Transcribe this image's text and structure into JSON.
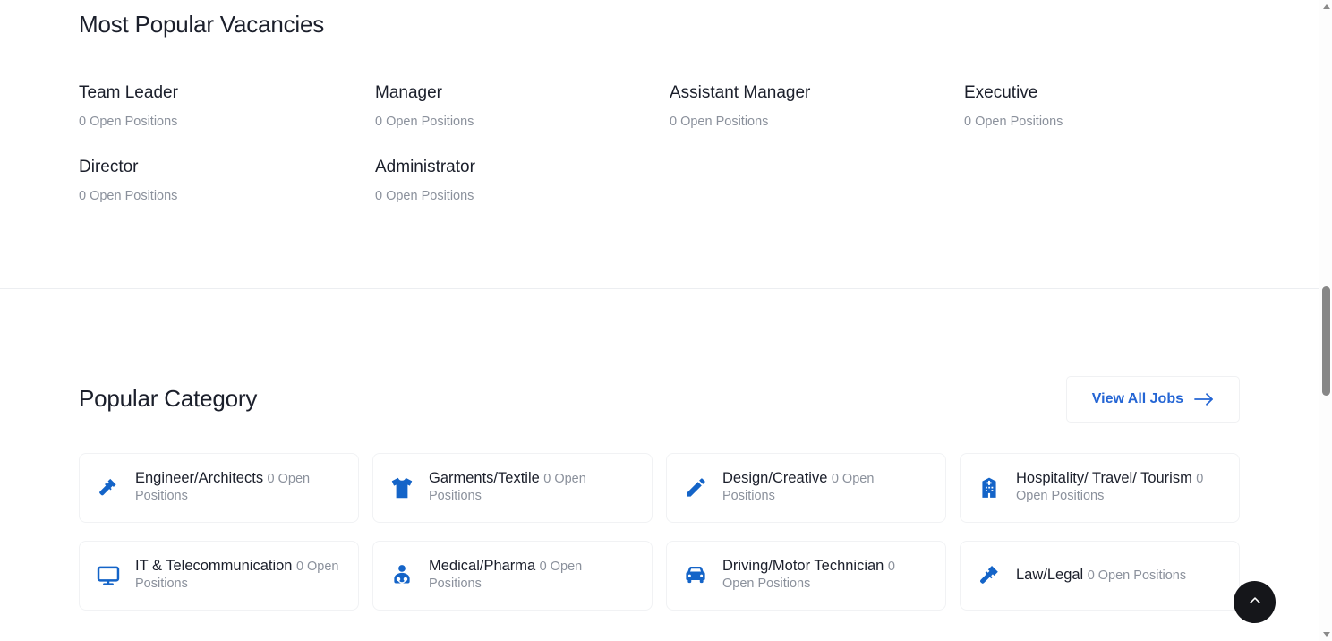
{
  "vacancies": {
    "title": "Most Popular Vacancies",
    "items": [
      {
        "name": "Team Leader",
        "count": "0 Open Positions"
      },
      {
        "name": "Manager",
        "count": "0 Open Positions"
      },
      {
        "name": "Assistant Manager",
        "count": "0 Open Positions"
      },
      {
        "name": "Executive",
        "count": "0 Open Positions"
      },
      {
        "name": "Director",
        "count": "0 Open Positions"
      },
      {
        "name": "Administrator",
        "count": "0 Open Positions"
      }
    ]
  },
  "category": {
    "title": "Popular Category",
    "view_all_label": "View All Jobs",
    "view_all_icon": "arrow-right-icon",
    "cards": [
      {
        "icon": "hammer-icon",
        "title": "Engineer/Architects",
        "count": "0 Open Positions"
      },
      {
        "icon": "tshirt-icon",
        "title": "Garments/Textile",
        "count": "0 Open Positions"
      },
      {
        "icon": "pencil-icon",
        "title": "Design/Creative",
        "count": "0 Open Positions"
      },
      {
        "icon": "hotel-icon",
        "title": "Hospitality/ Travel/ Tourism",
        "count": "0 Open Positions"
      },
      {
        "icon": "monitor-icon",
        "title": "IT & Telecommunication",
        "count": "0 Open Positions"
      },
      {
        "icon": "doctor-icon",
        "title": "Medical/Pharma",
        "count": "0 Open Positions"
      },
      {
        "icon": "car-icon",
        "title": "Driving/Motor Technician",
        "count": "0 Open Positions"
      },
      {
        "icon": "gavel-icon",
        "title": "Law/Legal",
        "count": "0 Open Positions"
      }
    ]
  },
  "scroll_top": {
    "icon": "chevron-up-icon"
  },
  "scrollbar": {
    "up_icon": "scroll-up-arrow-icon",
    "down_icon": "scroll-down-arrow-icon"
  },
  "colors": {
    "accent": "#2465d4",
    "icon": "#1464c8",
    "muted": "#8b919c",
    "fab": "#15161a"
  }
}
